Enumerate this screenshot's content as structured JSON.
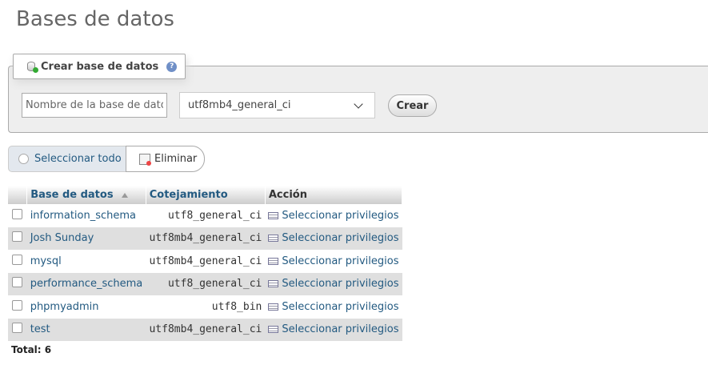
{
  "page": {
    "title": "Bases de datos"
  },
  "create_db": {
    "legend": "Crear base de datos",
    "name_placeholder": "Nombre de la base de datos",
    "collation_value": "utf8mb4_general_ci",
    "create_label": "Crear"
  },
  "toolbar": {
    "select_all_label": "Seleccionar todo",
    "delete_label": "Eliminar"
  },
  "table": {
    "headers": {
      "database": "Base de datos",
      "collation": "Cotejamiento",
      "action": "Acción"
    },
    "rows": [
      {
        "name": "information_schema",
        "collation": "utf8_general_ci",
        "action": "Seleccionar privilegios"
      },
      {
        "name": "Josh Sunday",
        "collation": "utf8mb4_general_ci",
        "action": "Seleccionar privilegios"
      },
      {
        "name": "mysql",
        "collation": "utf8mb4_general_ci",
        "action": "Seleccionar privilegios"
      },
      {
        "name": "performance_schema",
        "collation": "utf8_general_ci",
        "action": "Seleccionar privilegios"
      },
      {
        "name": "phpmyadmin",
        "collation": "utf8_bin",
        "action": "Seleccionar privilegios"
      },
      {
        "name": "test",
        "collation": "utf8mb4_general_ci",
        "action": "Seleccionar privilegios"
      }
    ],
    "total": "Total: 6"
  },
  "icons": {
    "legend": "database-add-icon",
    "help": "help-icon",
    "delete": "trash-icon",
    "privileges": "privileges-icon"
  },
  "colors": {
    "link": "#235a81",
    "fieldset_bg": "#eeeeee",
    "row_even": "#dfdfdf"
  }
}
